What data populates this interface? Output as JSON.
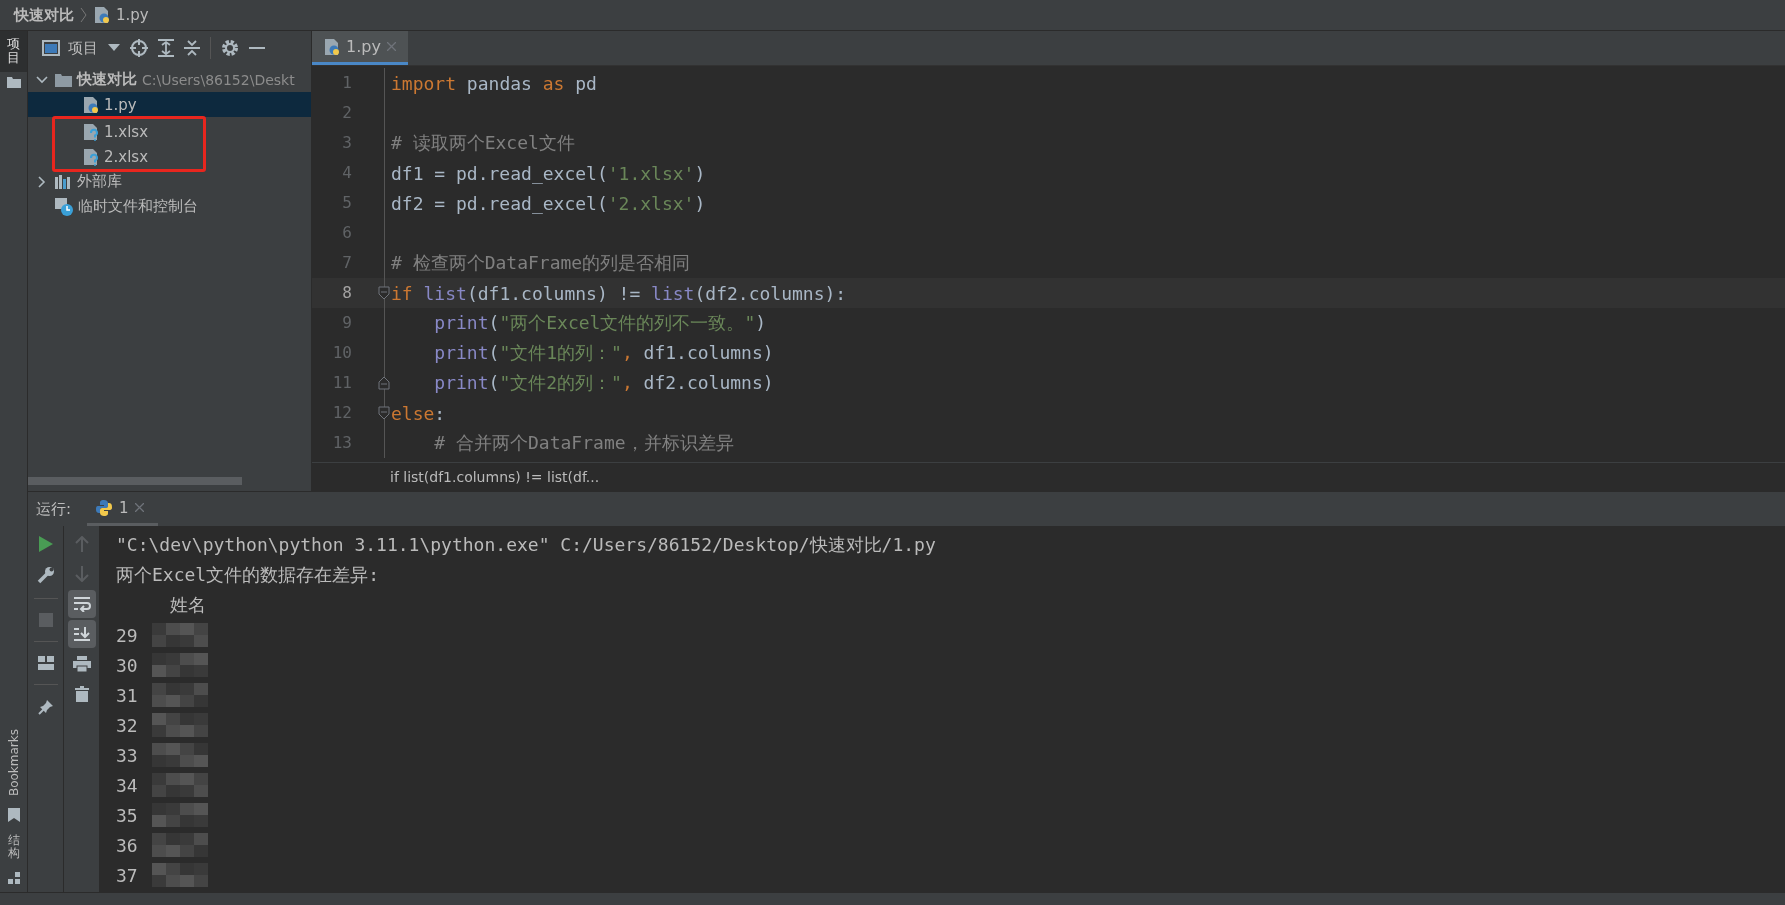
{
  "breadcrumb": [
    "快速对比",
    "1.py"
  ],
  "tool_stripe": {
    "top": [
      {
        "label": "项目",
        "selected": true
      }
    ],
    "bottom": [
      {
        "label": "Bookmarks",
        "kind": "bookmarks"
      },
      {
        "label": "结构",
        "kind": "structure"
      }
    ]
  },
  "project_panel": {
    "title": "项目",
    "tree": [
      {
        "label": "快速对比",
        "path": "C:\\Users\\86152\\Deskt",
        "kind": "folder",
        "expanded": true,
        "selected": false,
        "children": [
          {
            "label": "1.py",
            "kind": "python",
            "selected": true,
            "boxed": false
          },
          {
            "label": "1.xlsx",
            "kind": "unknown",
            "selected": false,
            "boxed": true
          },
          {
            "label": "2.xlsx",
            "kind": "unknown",
            "selected": false,
            "boxed": true
          }
        ]
      },
      {
        "label": "外部库",
        "kind": "library",
        "expanded": false,
        "selected": false
      },
      {
        "label": "临时文件和控制台",
        "kind": "scratch",
        "selected": false
      }
    ]
  },
  "editor": {
    "tabs": [
      {
        "label": "1.py",
        "selected": true
      }
    ],
    "lines": [
      {
        "number": "1",
        "current": false,
        "indented": false,
        "fold_start": false,
        "fold_end": false,
        "tokens": [
          {
            "t": "import",
            "kind": "keyword"
          },
          {
            "t": " pandas ",
            "kind": "plain"
          },
          {
            "t": "as",
            "kind": "keyword"
          },
          {
            "t": " pd",
            "kind": "plain"
          }
        ]
      },
      {
        "number": "2",
        "current": false,
        "fold_start": false,
        "fold_end": false
      },
      {
        "number": "3",
        "current": false,
        "indented": false,
        "fold_start": false,
        "fold_end": false,
        "tokens": [
          {
            "t": "# 读取两个Excel文件",
            "kind": "comment"
          }
        ]
      },
      {
        "number": "4",
        "current": false,
        "indented": false,
        "fold_start": false,
        "fold_end": false,
        "tokens": [
          {
            "t": "df1 = pd.read_excel(",
            "kind": "plain"
          },
          {
            "t": "'1.xlsx'",
            "kind": "string"
          },
          {
            "t": ")",
            "kind": "plain"
          }
        ]
      },
      {
        "number": "5",
        "current": false,
        "indented": false,
        "fold_start": false,
        "fold_end": false,
        "tokens": [
          {
            "t": "df2 = pd.read_excel(",
            "kind": "plain"
          },
          {
            "t": "'2.xlsx'",
            "kind": "string"
          },
          {
            "t": ")",
            "kind": "plain"
          }
        ]
      },
      {
        "number": "6",
        "current": false,
        "fold_start": false,
        "fold_end": false
      },
      {
        "number": "7",
        "current": false,
        "indented": false,
        "fold_start": false,
        "fold_end": false,
        "tokens": [
          {
            "t": "# 检查两个DataFrame的列是否相同",
            "kind": "comment"
          }
        ]
      },
      {
        "number": "8",
        "current": true,
        "indented": false,
        "fold_start": true,
        "fold_end": false,
        "tokens": [
          {
            "t": "if ",
            "kind": "keyword"
          },
          {
            "t": "list",
            "kind": "builtin"
          },
          {
            "t": "(df1.columns) != ",
            "kind": "plain"
          },
          {
            "t": "list",
            "kind": "builtin"
          },
          {
            "t": "(df2.columns):",
            "kind": "plain"
          }
        ]
      },
      {
        "number": "9",
        "current": false,
        "indented": true,
        "fold_start": false,
        "fold_end": false,
        "tokens": [
          {
            "t": "print",
            "kind": "builtin"
          },
          {
            "t": "(",
            "kind": "plain"
          },
          {
            "t": "\"两个Excel文件的列不一致。\"",
            "kind": "string"
          },
          {
            "t": ")",
            "kind": "plain"
          }
        ]
      },
      {
        "number": "10",
        "current": false,
        "indented": true,
        "fold_start": false,
        "fold_end": false,
        "tokens": [
          {
            "t": "print",
            "kind": "builtin"
          },
          {
            "t": "(",
            "kind": "plain"
          },
          {
            "t": "\"文件1的列：\"",
            "kind": "string"
          },
          {
            "t": ", ",
            "kind": "keyword"
          },
          {
            "t": "df1.columns)",
            "kind": "plain"
          }
        ]
      },
      {
        "number": "11",
        "current": false,
        "indented": true,
        "fold_start": false,
        "fold_end": true,
        "tokens": [
          {
            "t": "print",
            "kind": "builtin"
          },
          {
            "t": "(",
            "kind": "plain"
          },
          {
            "t": "\"文件2的列：\"",
            "kind": "string"
          },
          {
            "t": ", ",
            "kind": "keyword"
          },
          {
            "t": "df2.columns)",
            "kind": "plain"
          }
        ]
      },
      {
        "number": "12",
        "current": false,
        "indented": false,
        "fold_start": true,
        "fold_end": false,
        "tokens": [
          {
            "t": "else",
            "kind": "keyword"
          },
          {
            "t": ":",
            "kind": "plain"
          }
        ]
      },
      {
        "number": "13",
        "current": false,
        "indented": true,
        "fold_start": false,
        "fold_end": false,
        "tokens": [
          {
            "t": "# 合并两个DataFrame，并标识差异",
            "kind": "comment"
          }
        ]
      }
    ],
    "breadcrumb": "if list(df1.columns) != list(df..."
  },
  "run_panel": {
    "label": "运行:",
    "tabs": [
      {
        "label": "1",
        "selected": true
      }
    ],
    "console": [
      "\"C:\\dev\\python\\python 3.11.1\\python.exe\" C:/Users/86152/Desktop/快速对比/1.py",
      "两个Excel文件的数据存在差异:"
    ],
    "column_header": "姓名",
    "rows": [
      {
        "index": "29"
      },
      {
        "index": "30"
      },
      {
        "index": "31"
      },
      {
        "index": "32"
      },
      {
        "index": "33"
      },
      {
        "index": "34"
      },
      {
        "index": "35"
      },
      {
        "index": "36"
      },
      {
        "index": "37"
      }
    ]
  }
}
